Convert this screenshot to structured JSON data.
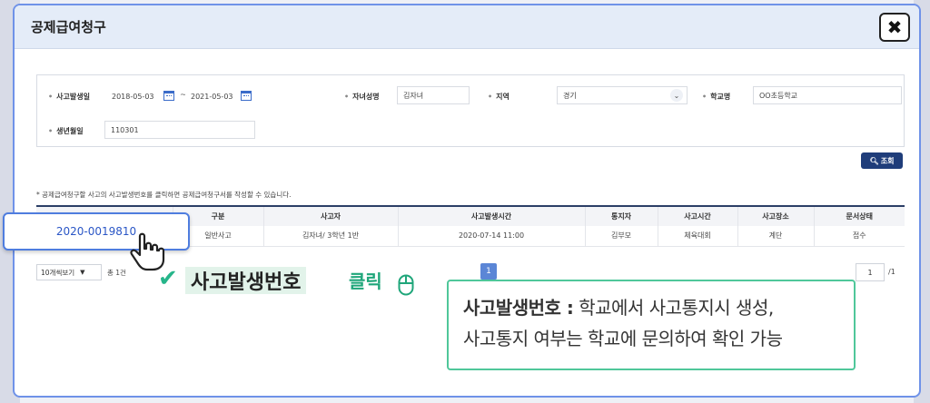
{
  "modal": {
    "title": "공제급여청구",
    "close_label": "✖"
  },
  "search": {
    "accident_date_label": "사고발생일",
    "date_from": "2018-05-03",
    "date_sep": "~",
    "date_to": "2021-05-03",
    "child_name_label": "자녀성명",
    "child_name_value": "김자녀",
    "region_label": "지역",
    "region_value": "경기",
    "school_label": "학교명",
    "school_value": "OO초등학교",
    "birth_label": "생년월일",
    "birth_value": "110301",
    "search_button_label": "조회"
  },
  "note": "* 공제급여청구할 사고의 사고발생번호를 클릭하면 공제급여청구서를 작성할 수 있습니다.",
  "table": {
    "headers": [
      "사고발생번호",
      "구분",
      "사고자",
      "사고발생시간",
      "통지자",
      "사고시간",
      "사고장소",
      "문서상태"
    ],
    "rows": [
      [
        "2020-0019810",
        "일반사고",
        "김자녀/ 3학년 1반",
        "2020-07-14 11:00",
        "김부모",
        "체육대회",
        "계단",
        "접수"
      ]
    ]
  },
  "pagination": {
    "per_page": "10개씩보기",
    "total": "총 1건",
    "current_page": "1",
    "page_input": "1",
    "page_total": "/1"
  },
  "callout": {
    "accident_number": "2020-0019810",
    "check_mark": "✔",
    "highlight_text": "사고발생번호",
    "click_text": "클릭"
  },
  "info": {
    "term": "사고발생번호 :",
    "line1_rest": " 학교에서 사고통지시 생성,",
    "line2": "사고통지 여부는 학교에 문의하여 확인 가능"
  },
  "colors": {
    "accent": "#1f3d7a",
    "highlight_green": "#1fa67a",
    "link_blue": "#2a56c6"
  }
}
